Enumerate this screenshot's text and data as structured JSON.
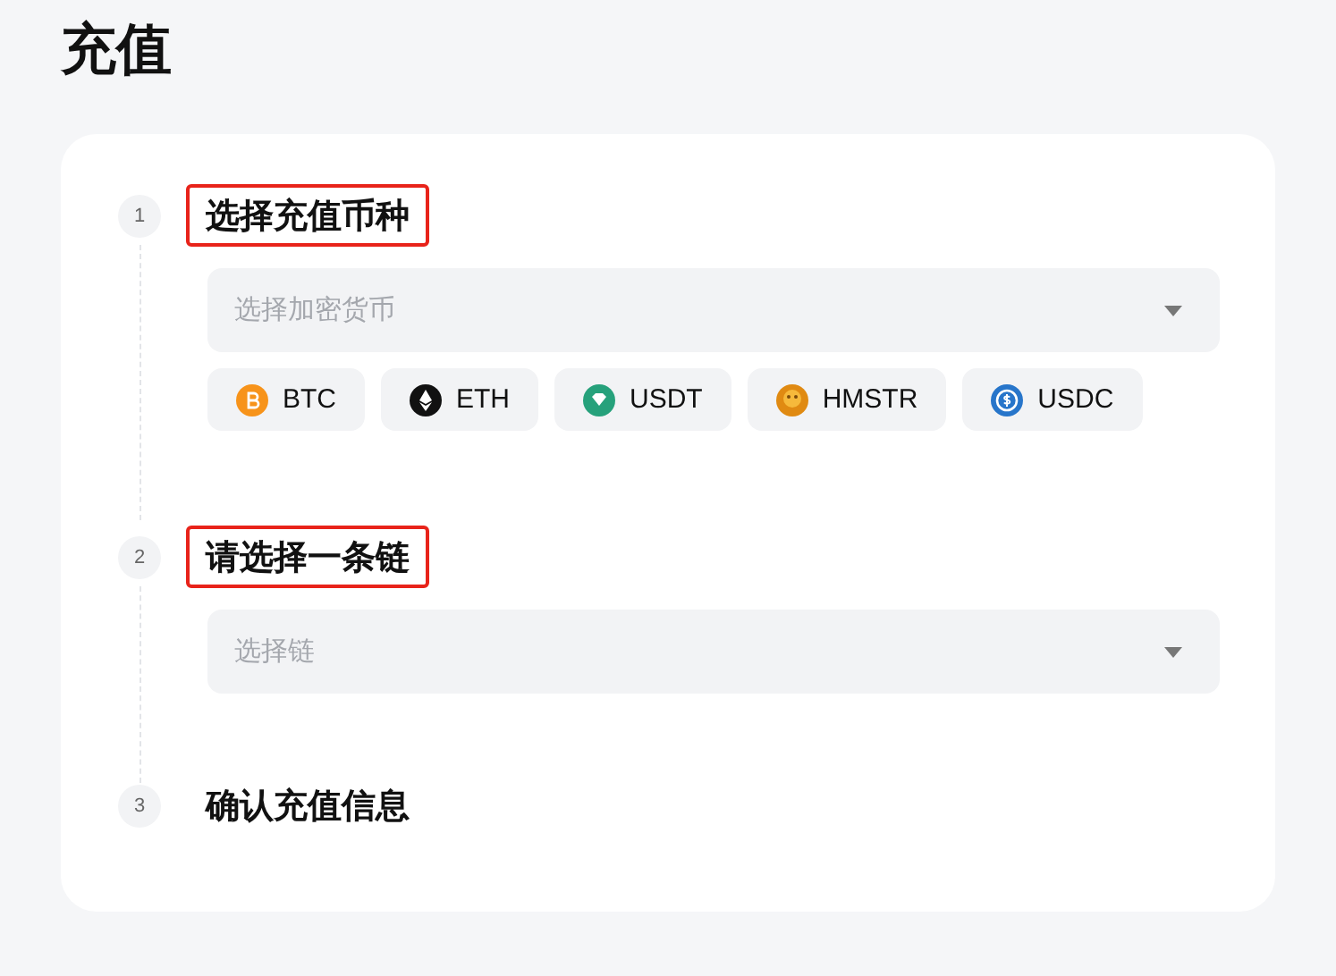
{
  "page_title": "充值",
  "steps": [
    {
      "number": "1",
      "title": "选择充值币种",
      "highlighted": true,
      "select": {
        "placeholder": "选择加密货币"
      },
      "coins": [
        {
          "kind": "btc",
          "label": "BTC"
        },
        {
          "kind": "eth",
          "label": "ETH"
        },
        {
          "kind": "usdt",
          "label": "USDT"
        },
        {
          "kind": "hmstr",
          "label": "HMSTR"
        },
        {
          "kind": "usdc",
          "label": "USDC"
        }
      ]
    },
    {
      "number": "2",
      "title": "请选择一条链",
      "highlighted": true,
      "select": {
        "placeholder": "选择链"
      }
    },
    {
      "number": "3",
      "title": "确认充值信息",
      "highlighted": false
    }
  ]
}
